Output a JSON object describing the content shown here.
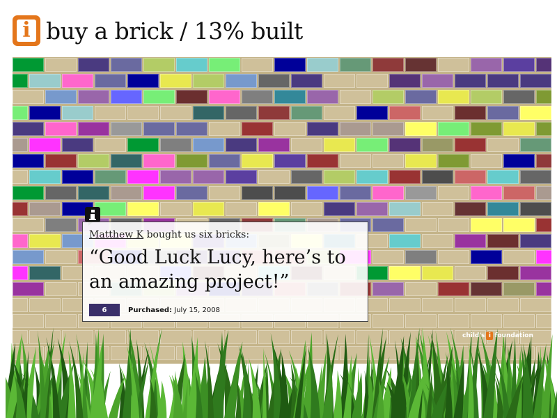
{
  "header": {
    "title": "buy a brick / 13% built",
    "icon": "info-icon"
  },
  "wall": {
    "mortar_color": "#c4b489",
    "brick_colors": [
      "#6b2f2f",
      "#8f3a3a",
      "#6a6aa0",
      "#ffff66",
      "#666666",
      "#99cccc",
      "#999966",
      "#000099",
      "#999999",
      "#66cccc",
      "#993333",
      "#ff66cc",
      "#7f7f7f",
      "#5b3fa0",
      "#4a3a80",
      "#e8e850",
      "#669977",
      "#aa9a90",
      "#009933",
      "#b3cc66",
      "#ff33ff",
      "#77ee77",
      "#553377",
      "#99339f",
      "#338899",
      "#7799cc",
      "#cc6666",
      "#336666",
      "#6666ff",
      "#7f9a33",
      "#4d4d4d",
      "#9966aa",
      "#663333"
    ]
  },
  "popup": {
    "buyer_name": "Matthew K",
    "buyer_suffix": "bought us six bricks:",
    "message": "“Good Luck Lucy, here’s to an amazing project!”",
    "count": "6",
    "purchased_label": "Purchased:",
    "purchased_date": "July 15, 2008"
  },
  "footer_logo": {
    "left": "child's",
    "right": "foundation"
  }
}
